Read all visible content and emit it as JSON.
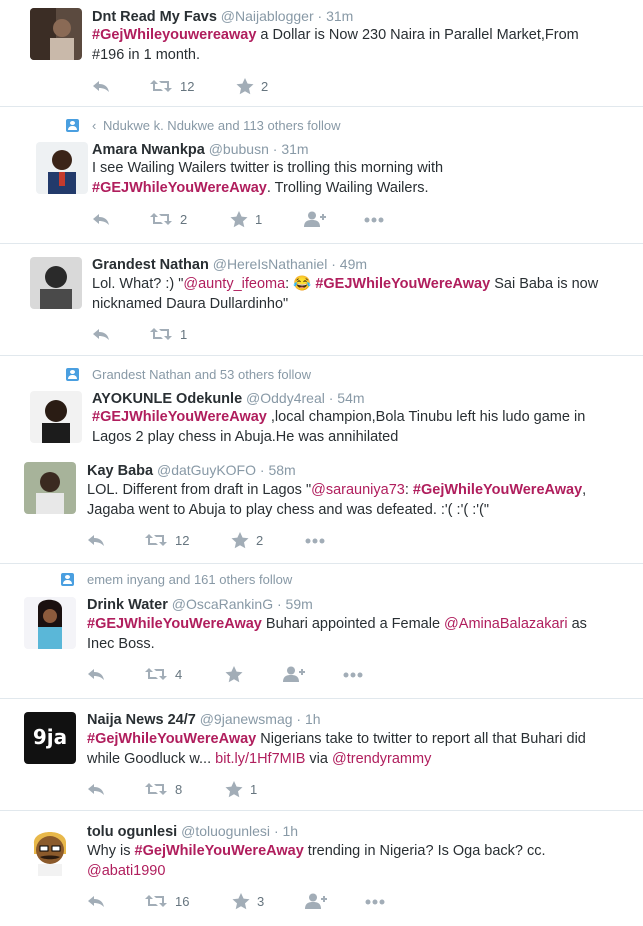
{
  "tweets": [
    {
      "name": "Dnt Read My Favs",
      "handle": "@Naijablogger",
      "time": "· 31m",
      "line1": [
        {
          "t": "#GejWhileyouwereaway",
          "c": "tag"
        },
        {
          "t": " a Dollar is Now 230 Naira in Parallel Market,From",
          "c": ""
        }
      ],
      "line2": [
        {
          "t": "#196 in 1 month.",
          "c": ""
        }
      ],
      "retweets": "12",
      "favorites": "2"
    },
    {
      "context": "Ndukwe k. Ndukwe and 113 others follow",
      "name": "Amara Nwankpa",
      "handle": "@bubusn",
      "time": "· 31m",
      "line1": [
        {
          "t": "I see Wailing Wailers twitter is trolling this morning with",
          "c": ""
        }
      ],
      "line2": [
        {
          "t": "#GEJWhileYouWereAway",
          "c": "tag"
        },
        {
          "t": ". Trolling Wailing Wailers.",
          "c": ""
        }
      ],
      "retweets": "2",
      "favorites": "1"
    },
    {
      "name": "Grandest Nathan",
      "handle": "@HereIsNathaniel",
      "time": "· 49m",
      "line1": [
        {
          "t": "Lol. What? :) \"",
          "c": ""
        },
        {
          "t": "@aunty_ifeoma",
          "c": "mention"
        },
        {
          "t": ": 😂 ",
          "c": ""
        },
        {
          "t": "#GEJWhileYouWereAway",
          "c": "tag"
        },
        {
          "t": " Sai Baba is now",
          "c": ""
        }
      ],
      "line2": [
        {
          "t": "nicknamed Daura Dullardinho\"",
          "c": ""
        }
      ],
      "retweets": "1",
      "favorites": ""
    },
    {
      "context": "Grandest Nathan and 53 others follow",
      "name": "AYOKUNLE Odekunle",
      "handle": "@Oddy4real",
      "time": "· 54m",
      "line1": [
        {
          "t": "#GEJWhileYouWereAway",
          "c": "tag"
        },
        {
          "t": " ,local champion,Bola Tinubu left his ludo game in",
          "c": ""
        }
      ],
      "line2": [
        {
          "t": "Lagos 2 play chess in Abuja.He was annihilated",
          "c": ""
        }
      ]
    },
    {
      "name": "Kay Baba",
      "handle": "@datGuyKOFO",
      "time": "· 58m",
      "line1": [
        {
          "t": "LOL. Different from draft in Lagos \"",
          "c": ""
        },
        {
          "t": "@sarauniya73",
          "c": "mention"
        },
        {
          "t": ": ",
          "c": ""
        },
        {
          "t": "#GejWhileYouWereAway",
          "c": "tag"
        },
        {
          "t": ",",
          "c": ""
        }
      ],
      "line2": [
        {
          "t": "Jagaba went to Abuja to play chess and was defeated. :'( :'( :'(\"",
          "c": ""
        }
      ],
      "retweets": "12",
      "favorites": "2"
    },
    {
      "context": "emem inyang and 161 others follow",
      "name": "Drink Water",
      "handle": "@OscaRankinG",
      "time": "· 59m",
      "line1": [
        {
          "t": "#GEJWhileYouWereAway",
          "c": "tag"
        },
        {
          "t": " Buhari appointed a Female ",
          "c": ""
        },
        {
          "t": "@AminaBalazakari",
          "c": "mention"
        },
        {
          "t": " as",
          "c": ""
        }
      ],
      "line2": [
        {
          "t": "Inec Boss.",
          "c": ""
        }
      ],
      "retweets": "4",
      "favorites": ""
    },
    {
      "name": "Naija News 24/7",
      "handle": "@9janewsmag",
      "time": "· 1h",
      "line1": [
        {
          "t": "#GejWhileYouWereAway",
          "c": "tag"
        },
        {
          "t": " Nigerians take to twitter to report all that Buhari did",
          "c": ""
        }
      ],
      "line2": [
        {
          "t": "while Goodluck w... ",
          "c": ""
        },
        {
          "t": "bit.ly/1Hf7MIB",
          "c": "link"
        },
        {
          "t": " via ",
          "c": ""
        },
        {
          "t": "@trendyrammy",
          "c": "mention"
        }
      ],
      "retweets": "8",
      "favorites": "1"
    },
    {
      "name": "tolu ogunlesi",
      "handle": "@toluogunlesi",
      "time": "· 1h",
      "line1": [
        {
          "t": "Why is ",
          "c": ""
        },
        {
          "t": "#GejWhileYouWereAway",
          "c": "tag"
        },
        {
          "t": " trending in Nigeria? Is Oga back? cc.",
          "c": ""
        }
      ],
      "line2": [
        {
          "t": "@abati1990",
          "c": "mention"
        }
      ],
      "retweets": "16",
      "favorites": "3"
    }
  ],
  "avatar_labels": {
    "naija_news": "9ja"
  },
  "colors": {
    "hashtag": "#b01e5d",
    "meta": "#8899a6",
    "action": "#a2adb7",
    "divider": "#e1e8ed"
  },
  "icons": [
    "reply-icon",
    "retweet-icon",
    "favorite-icon",
    "follow-icon",
    "more-icon",
    "follow-context-icon"
  ]
}
